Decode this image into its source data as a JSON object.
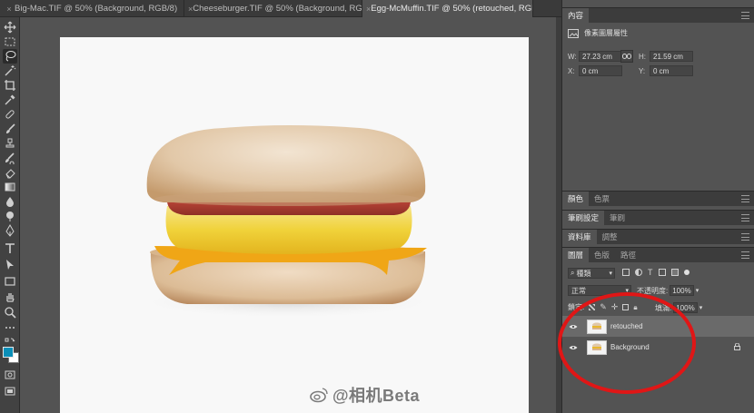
{
  "tabs": [
    {
      "label": "Big-Mac.TIF @ 50% (Background, RGB/8)",
      "active": false
    },
    {
      "label": "Cheeseburger.TIF @ 50% (Background, RGB/8)",
      "active": false
    },
    {
      "label": "Egg-McMuffin.TIF @ 50% (retouched, RGB/8)",
      "active": true
    }
  ],
  "tab_close_glyph": "×",
  "toolbar_icons": [
    "move-icon",
    "marquee-icon",
    "lasso-icon",
    "magic-wand-icon",
    "crop-icon",
    "eyedropper-icon",
    "healing-brush-icon",
    "brush-icon",
    "clone-stamp-icon",
    "history-brush-icon",
    "eraser-icon",
    "gradient-icon",
    "blur-icon",
    "dodge-icon",
    "pen-icon",
    "type-icon",
    "path-select-icon",
    "rectangle-icon",
    "hand-icon",
    "zoom-icon",
    "more-icon"
  ],
  "colors": {
    "foreground": "#0a8fb8",
    "background": "#ffffff",
    "annotation": "#e01616"
  },
  "properties": {
    "tab": "內容",
    "section": "像素圖層屬性",
    "w_label": "W:",
    "w_value": "27.23 cm",
    "h_label": "H:",
    "h_value": "21.59 cm",
    "x_label": "X:",
    "x_value": "0 cm",
    "y_label": "Y:",
    "y_value": "0 cm"
  },
  "color_panel": {
    "tabs": [
      "顏色",
      "色票"
    ]
  },
  "brush_panel": {
    "tabs": [
      "筆刷設定",
      "筆刷"
    ]
  },
  "library_panel": {
    "tabs": [
      "資料庫",
      "調整"
    ]
  },
  "layers_panel": {
    "tabs": [
      "圖層",
      "色版",
      "路徑"
    ],
    "filter_kind": "種類",
    "blend_mode": "正常",
    "opacity_label": "不透明度:",
    "opacity_value": "100%",
    "lock_label": "鎖定:",
    "fill_label": "填滿:",
    "fill_value": "100%",
    "layers": [
      {
        "name": "retouched",
        "selected": true,
        "locked": false
      },
      {
        "name": "Background",
        "selected": false,
        "locked": true
      }
    ]
  },
  "watermark": {
    "handle": "@相机Beta"
  }
}
